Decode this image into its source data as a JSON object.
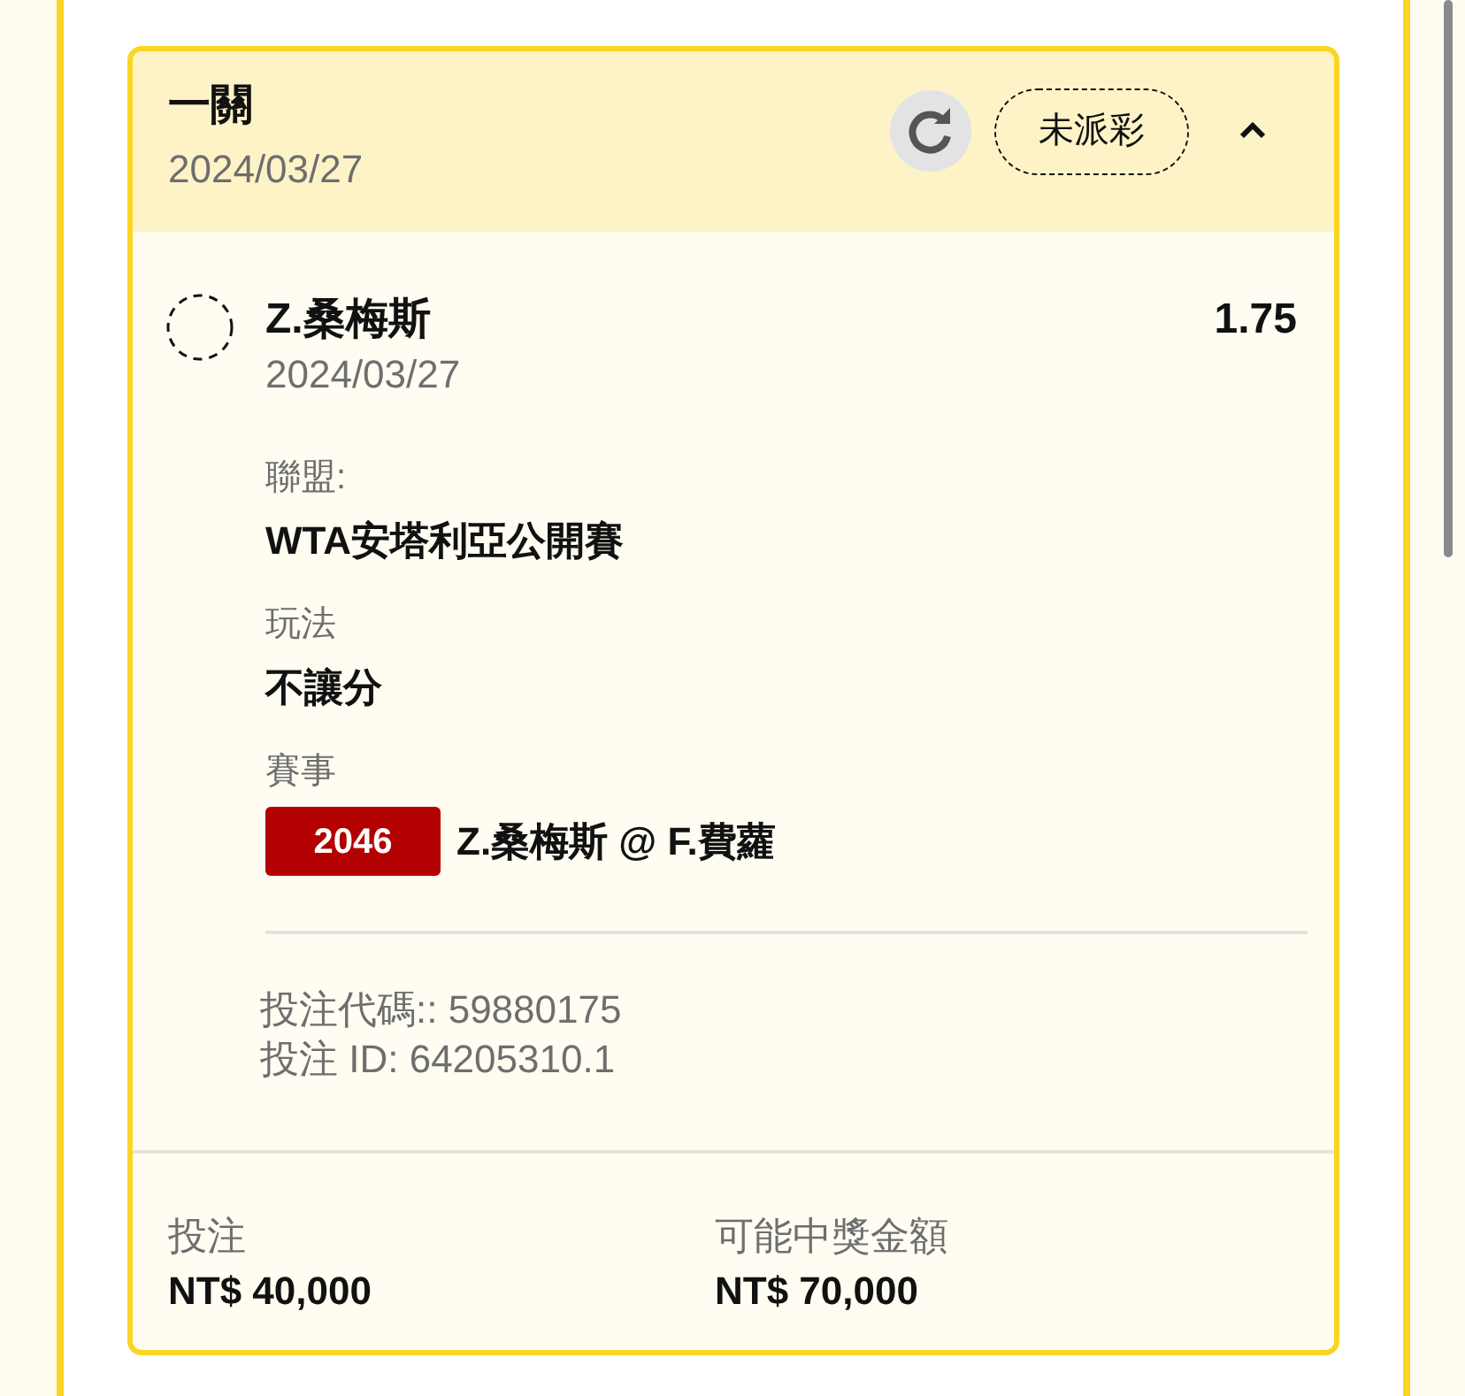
{
  "bet_card": {
    "title": "一關",
    "date": "2024/03/27",
    "status": "未派彩",
    "expanded": true,
    "selection": {
      "name": "Z.桑梅斯",
      "odds": "1.75",
      "date": "2024/03/27",
      "details": [
        {
          "kind": "text",
          "label": "聯盟:",
          "value": "WTA安塔利亞公開賽"
        },
        {
          "kind": "text",
          "label": "玩法",
          "value": "不讓分"
        },
        {
          "kind": "event",
          "label": "賽事",
          "event_code": "2046",
          "value": "Z.桑梅斯 @ F.費蘿"
        }
      ],
      "bet_code": "投注代碼:: 59880175",
      "bet_id": "投注 ID: 64205310.1"
    },
    "totals": [
      {
        "label": "投注",
        "value": "NT$ 40,000"
      },
      {
        "label": "可能中獎金額",
        "value": "NT$ 70,000"
      }
    ]
  }
}
